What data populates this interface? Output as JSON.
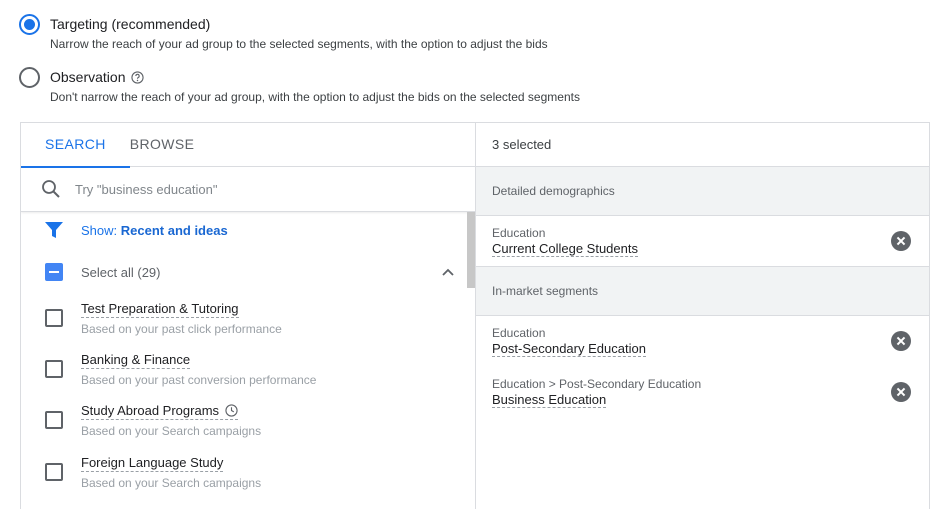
{
  "options": {
    "targeting": {
      "label": "Targeting (recommended)",
      "description": "Narrow the reach of your ad group to the selected segments, with the option to adjust the bids",
      "selected": true
    },
    "observation": {
      "label": "Observation",
      "description": "Don't narrow the reach of your ad group, with the option to adjust the bids on the selected segments",
      "selected": false,
      "icon": "help-circle-icon"
    }
  },
  "left_panel": {
    "tabs": [
      {
        "label": "SEARCH",
        "active": true
      },
      {
        "label": "BROWSE",
        "active": false
      }
    ],
    "search": {
      "placeholder": "Try \"business education\"",
      "value": "",
      "icon": "search-icon"
    },
    "filter": {
      "prefix": "Show:",
      "value": "Recent and ideas",
      "icon": "filter-icon"
    },
    "select_all": {
      "label": "Select all (29)",
      "state": "indeterminate"
    },
    "items": [
      {
        "name": "Test Preparation & Tutoring",
        "sub": "Based on your past click performance",
        "checked": false
      },
      {
        "name": "Banking & Finance",
        "sub": "Based on your past conversion performance",
        "checked": false
      },
      {
        "name": "Study Abroad Programs",
        "sub": "Based on your Search campaigns",
        "checked": false,
        "icon": "clock-icon"
      },
      {
        "name": "Foreign Language Study",
        "sub": "Based on your Search campaigns",
        "checked": false
      }
    ]
  },
  "right_panel": {
    "header": "3 selected",
    "groups": [
      {
        "title": "Detailed demographics",
        "items": [
          {
            "category": "Education",
            "name": "Current College Students"
          }
        ]
      },
      {
        "title": "In-market segments",
        "items": [
          {
            "category": "Education",
            "name": "Post-Secondary Education"
          },
          {
            "category": "Education > Post-Secondary Education",
            "name": "Business Education"
          }
        ]
      }
    ]
  },
  "colors": {
    "accent": "#1a73e8",
    "checkbox_fill": "#4285f4",
    "group_bg": "#f1f3f4"
  }
}
